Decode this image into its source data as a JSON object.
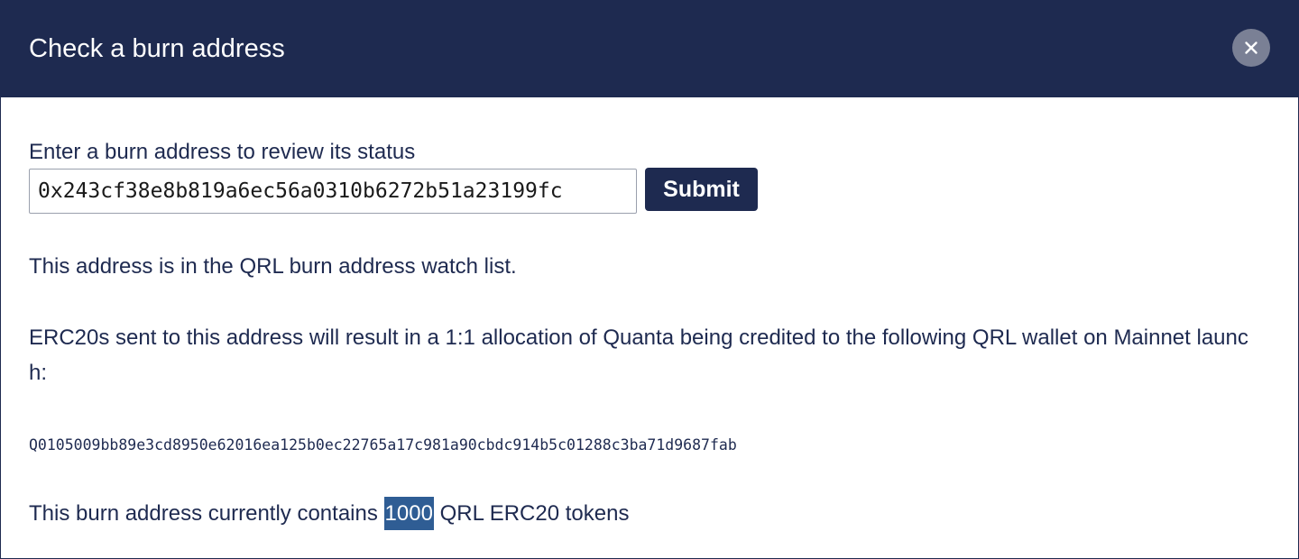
{
  "modal": {
    "title": "Check a burn address",
    "close_icon": "close-icon"
  },
  "form": {
    "label": "Enter a burn address to review its status",
    "input_value": "0x243cf38e8b819a6ec56a0310b6272b51a23199fc",
    "submit_label": "Submit"
  },
  "result": {
    "status": "This address is in the QRL burn address watch list.",
    "erc_text": "ERC20s sent to this address will result in a 1:1 allocation of Quanta being credited to the following QRL wallet on Mainnet launch:",
    "wallet_address": "Q0105009bb89e3cd8950e62016ea125b0ec22765a17c981a90cbdc914b5c01288c3ba71d9687fab",
    "balance_prefix": "This burn address currently contains",
    "balance_amount": "1000",
    "balance_suffix": "QRL ERC20 tokens"
  },
  "colors": {
    "header_bg": "#1e2a50",
    "text": "#1e2a50",
    "close_bg": "#7a8095",
    "highlight": "#2f5d94"
  }
}
